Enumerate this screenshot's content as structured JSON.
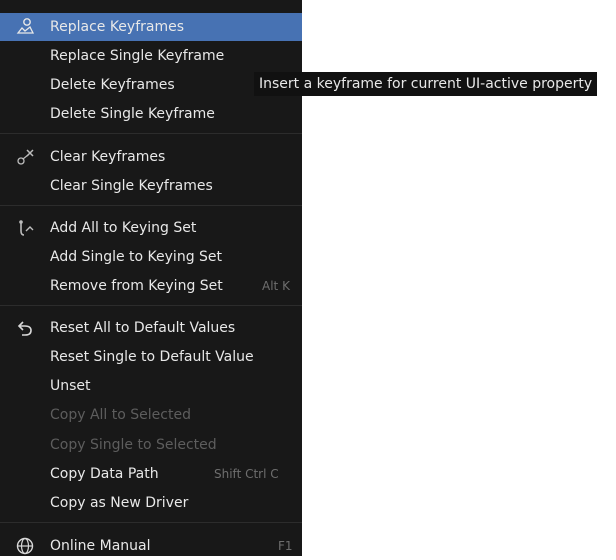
{
  "menu": {
    "items": [
      {
        "label": "Replace Keyframes",
        "icon": "keyframe-replace-icon"
      },
      {
        "label": "Replace Single Keyframe"
      },
      {
        "label": "Delete Keyframes"
      },
      {
        "label": "Delete Single Keyframe"
      },
      {
        "label": "Clear Keyframes",
        "icon": "keyframe-clear-icon"
      },
      {
        "label": "Clear Single Keyframes"
      },
      {
        "label": "Add All to Keying Set",
        "icon": "keying-set-icon"
      },
      {
        "label": "Add Single to Keying Set"
      },
      {
        "label": "Remove from Keying Set",
        "shortcut": "Alt K"
      },
      {
        "label": "Reset All to Default Values",
        "icon": "reset-arrow-icon"
      },
      {
        "label": "Reset Single to Default Value"
      },
      {
        "label": "Unset"
      },
      {
        "label": "Copy All to Selected"
      },
      {
        "label": "Copy Single to Selected"
      },
      {
        "label": "Copy Data Path",
        "shortcut": "Shift Ctrl C"
      },
      {
        "label": "Copy as New Driver"
      },
      {
        "label": "Online Manual",
        "icon": "globe-icon",
        "shortcut": "F1"
      }
    ]
  },
  "tooltip": {
    "text": "Insert a keyframe for current UI-active property"
  },
  "colors": {
    "menu_bg": "#181818",
    "highlight": "#4772b3",
    "text": "#e8e8e8",
    "disabled_text": "#5d5d5d",
    "shortcut_text": "#6e6e6e"
  }
}
